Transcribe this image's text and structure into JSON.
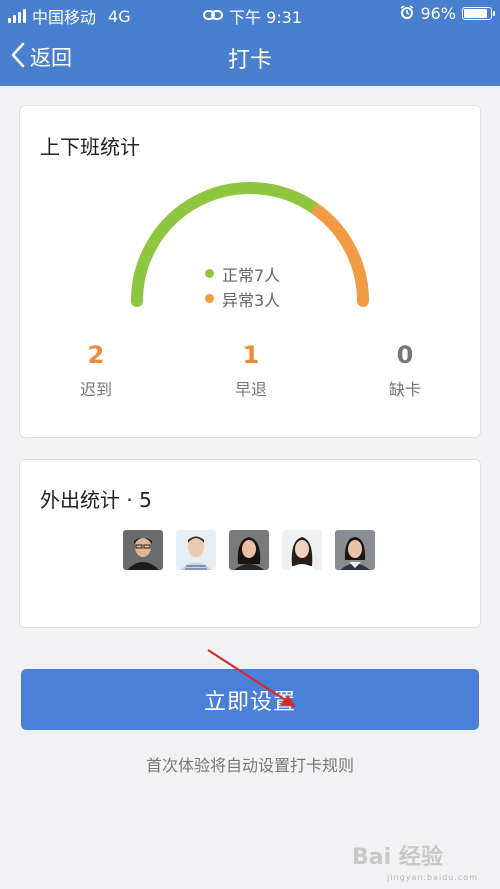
{
  "status_bar": {
    "carrier": "中国移动",
    "network": "4G",
    "time": "下午 9:31",
    "battery_text": "96%",
    "battery_level": 0.96
  },
  "nav": {
    "back_label": "返回",
    "title": "打卡"
  },
  "attendance": {
    "title": "上下班统计",
    "gauge": {
      "normal_count": 7,
      "abnormal_count": 3,
      "normal_color": "#8ec63f",
      "abnormal_color": "#f39a45"
    },
    "legend": [
      {
        "label": "正常7人",
        "color": "#8ec63f"
      },
      {
        "label": "异常3人",
        "color": "#f39a45"
      }
    ],
    "stats": [
      {
        "value": "2",
        "label": "迟到",
        "color": "#ee8a3d"
      },
      {
        "value": "1",
        "label": "早退",
        "color": "#ee8a3d"
      },
      {
        "value": "0",
        "label": "缺卡",
        "color": "#777777"
      }
    ]
  },
  "outing": {
    "title": "外出统计 · 5",
    "avatars": [
      "avatar-person-1",
      "avatar-person-2",
      "avatar-person-3",
      "avatar-person-4",
      "avatar-person-5"
    ]
  },
  "action": {
    "button_label": "立即设置",
    "hint": "首次体验将自动设置打卡规则"
  },
  "watermark": {
    "brand": "Bai 经验",
    "url": "jingyan.baidu.com"
  },
  "colors": {
    "header": "#4a7fd0",
    "button": "#4a80d8"
  }
}
